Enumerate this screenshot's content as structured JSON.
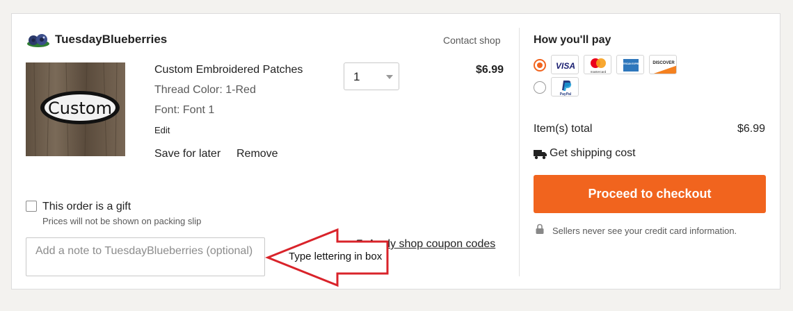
{
  "shop": {
    "name": "TuesdayBlueberries",
    "contact_label": "Contact shop",
    "logo_icon": "blueberries-logo"
  },
  "item": {
    "title": "Custom Embroidered Patches",
    "variations": [
      "Thread Color: 1-Red",
      "Font: Font 1"
    ],
    "edit_label": "Edit",
    "image_text": "Custom",
    "quantity": "1",
    "price": "$6.99",
    "save_for_later_label": "Save for later",
    "remove_label": "Remove"
  },
  "gift": {
    "label": "This order is a gift",
    "sublabel": "Prices will not be shown on packing slip",
    "checked": false
  },
  "note": {
    "placeholder": "Add a note to TuesdayBlueberries (optional)"
  },
  "coupon": {
    "label": "Apply shop coupon codes"
  },
  "annotation": {
    "text": "Type lettering in box",
    "color": "#d9232a"
  },
  "payment": {
    "title": "How you'll pay",
    "methods": [
      {
        "selected": true,
        "cards": [
          "VISA",
          "mastercard",
          "AMERICAN EXPRESS",
          "DISCOVER"
        ]
      },
      {
        "selected": false,
        "cards": [
          "PayPal"
        ]
      }
    ],
    "items_total_label": "Item(s) total",
    "items_total_value": "$6.99",
    "shipping_label": "Get shipping cost",
    "checkout_label": "Proceed to checkout",
    "secure_text": "Sellers never see your credit card information.",
    "accent": "#f1641e"
  }
}
